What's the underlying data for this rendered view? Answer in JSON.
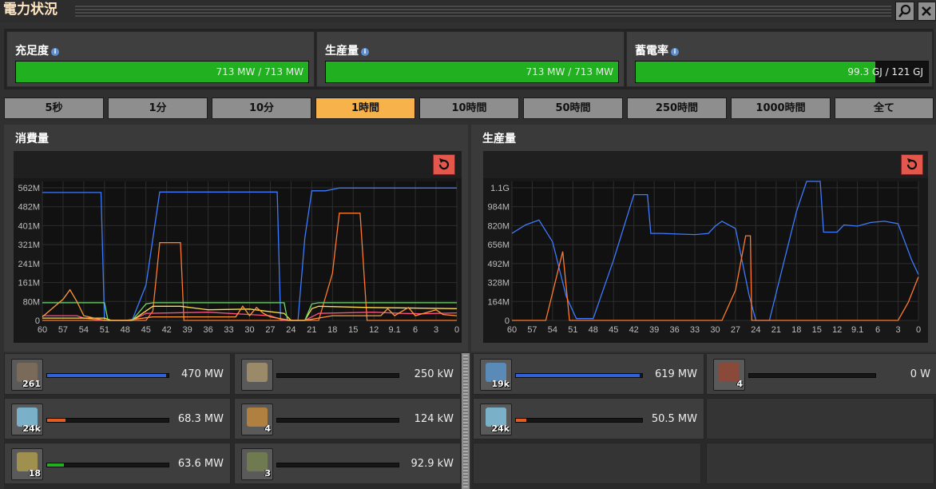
{
  "window": {
    "title": "電力状況"
  },
  "stats": [
    {
      "label": "充足度",
      "value_text": "713 MW / 713 MW",
      "fill": 1.0
    },
    {
      "label": "生産量",
      "value_text": "713 MW / 713 MW",
      "fill": 1.0
    },
    {
      "label": "蓄電率",
      "value_text": "99.3 GJ / 121 GJ",
      "fill": 0.82
    }
  ],
  "time_tabs": [
    "5秒",
    "1分",
    "10分",
    "1時間",
    "10時間",
    "50時間",
    "250時間",
    "1000時間",
    "全て"
  ],
  "active_tab": "1時間",
  "panels": {
    "consumption": {
      "title": "消費量"
    },
    "production": {
      "title": "生産量"
    }
  },
  "icons": {
    "search": "search-icon",
    "close": "close-icon",
    "reset": "reset-icon",
    "info": "info-icon"
  },
  "colors": {
    "bar_green": "#21b01f",
    "tab_active": "#f7b24c",
    "reset_red": "#e4574b",
    "series_blue": "#3d7bff",
    "series_orange": "#ff7a2e"
  },
  "chart_data": [
    {
      "type": "line",
      "x_ticks": [
        "60",
        "57",
        "54",
        "51",
        "48",
        "45",
        "42",
        "39",
        "36",
        "33",
        "30",
        "27",
        "24",
        "21",
        "18",
        "15",
        "12",
        "9.1",
        "6",
        "3",
        "0"
      ],
      "y_ticks": [
        "0",
        "80M",
        "161M",
        "241M",
        "321M",
        "401M",
        "482M",
        "562M"
      ],
      "ylim": [
        0,
        590
      ],
      "series": [
        {
          "color": "#3d7bff",
          "points": [
            [
              60,
              543
            ],
            [
              51.5,
              543
            ],
            [
              51,
              0
            ],
            [
              47,
              0
            ],
            [
              45,
              150
            ],
            [
              43,
              545
            ],
            [
              31,
              545
            ],
            [
              26,
              545
            ],
            [
              25.5,
              0
            ],
            [
              23,
              0
            ],
            [
              22,
              350
            ],
            [
              21,
              550
            ],
            [
              19,
              550
            ],
            [
              17,
              562
            ],
            [
              0,
              562
            ]
          ]
        },
        {
          "color": "#ff7a2e",
          "points": [
            [
              60,
              0
            ],
            [
              49,
              0
            ],
            [
              45,
              0
            ],
            [
              44,
              40
            ],
            [
              43,
              330
            ],
            [
              40,
              330
            ],
            [
              39.5,
              0
            ],
            [
              20,
              0
            ],
            [
              18,
              200
            ],
            [
              17,
              455
            ],
            [
              14,
              455
            ],
            [
              13,
              0
            ],
            [
              0,
              0
            ]
          ]
        },
        {
          "color": "#ff5080",
          "points": [
            [
              60,
              20
            ],
            [
              55,
              20
            ],
            [
              54,
              10
            ],
            [
              51,
              0
            ],
            [
              47,
              0
            ],
            [
              45,
              30
            ],
            [
              36,
              35
            ],
            [
              33,
              30
            ],
            [
              30,
              25
            ],
            [
              27,
              20
            ],
            [
              25,
              0
            ],
            [
              22,
              0
            ],
            [
              20,
              30
            ],
            [
              12,
              35
            ],
            [
              8,
              30
            ],
            [
              5,
              28
            ],
            [
              0,
              32
            ]
          ]
        },
        {
          "color": "#ffe14a",
          "points": [
            [
              60,
              10
            ],
            [
              51,
              10
            ],
            [
              50,
              0
            ],
            [
              47,
              0
            ],
            [
              45,
              40
            ],
            [
              44,
              60
            ],
            [
              40,
              60
            ],
            [
              36,
              45
            ],
            [
              30,
              48
            ],
            [
              25,
              30
            ],
            [
              24,
              0
            ],
            [
              22,
              0
            ],
            [
              21,
              50
            ],
            [
              20,
              60
            ],
            [
              13,
              55
            ],
            [
              0,
              50
            ]
          ]
        },
        {
          "color": "#6ed96e",
          "points": [
            [
              60,
              75
            ],
            [
              51,
              75
            ],
            [
              50.5,
              0
            ],
            [
              47,
              0
            ],
            [
              45,
              70
            ],
            [
              44,
              75
            ],
            [
              25,
              75
            ],
            [
              24.5,
              0
            ],
            [
              22,
              0
            ],
            [
              21,
              70
            ],
            [
              20,
              75
            ],
            [
              0,
              75
            ]
          ]
        },
        {
          "color": "#ff9a3a",
          "points": [
            [
              60,
              15
            ],
            [
              59,
              40
            ],
            [
              57,
              90
            ],
            [
              56,
              130
            ],
            [
              55,
              80
            ],
            [
              54,
              20
            ],
            [
              51,
              0
            ],
            [
              48,
              0
            ],
            [
              44,
              15
            ],
            [
              32,
              15
            ],
            [
              31,
              60
            ],
            [
              30,
              20
            ],
            [
              29,
              55
            ],
            [
              28,
              30
            ],
            [
              27,
              15
            ],
            [
              24,
              0
            ],
            [
              22,
              0
            ],
            [
              18,
              20
            ],
            [
              11,
              20
            ],
            [
              10,
              50
            ],
            [
              9,
              20
            ],
            [
              7,
              55
            ],
            [
              6,
              20
            ],
            [
              3,
              45
            ],
            [
              2,
              25
            ],
            [
              0,
              20
            ]
          ]
        }
      ]
    },
    {
      "type": "line",
      "x_ticks": [
        "60",
        "57",
        "54",
        "51",
        "48",
        "45",
        "42",
        "39",
        "36",
        "33",
        "30",
        "27",
        "24",
        "21",
        "18",
        "15",
        "12",
        "9.1",
        "6",
        "3",
        "0"
      ],
      "y_ticks": [
        "0",
        "164M",
        "328M",
        "492M",
        "656M",
        "820M",
        "984M",
        "1.1G"
      ],
      "ylim": [
        0,
        1150
      ],
      "series": [
        {
          "color": "#3d7bff",
          "points": [
            [
              60,
              720
            ],
            [
              58,
              790
            ],
            [
              56,
              830
            ],
            [
              54,
              650
            ],
            [
              52,
              200
            ],
            [
              50.5,
              15
            ],
            [
              48,
              15
            ],
            [
              45,
              500
            ],
            [
              42,
              1040
            ],
            [
              40,
              1040
            ],
            [
              39.5,
              720
            ],
            [
              38,
              720
            ],
            [
              33,
              710
            ],
            [
              31,
              720
            ],
            [
              30,
              780
            ],
            [
              29,
              820
            ],
            [
              27,
              760
            ],
            [
              25,
              210
            ],
            [
              24,
              0
            ],
            [
              22,
              0
            ],
            [
              20,
              450
            ],
            [
              18,
              900
            ],
            [
              16.5,
              1150
            ],
            [
              14.5,
              1150
            ],
            [
              14,
              730
            ],
            [
              12,
              730
            ],
            [
              11,
              790
            ],
            [
              9,
              780
            ],
            [
              7,
              810
            ],
            [
              5,
              820
            ],
            [
              3,
              800
            ],
            [
              2,
              650
            ],
            [
              1,
              500
            ],
            [
              0,
              380
            ]
          ]
        },
        {
          "color": "#ff7a2e",
          "points": [
            [
              60,
              0
            ],
            [
              55,
              0
            ],
            [
              52.5,
              570
            ],
            [
              51.5,
              0
            ],
            [
              29,
              0
            ],
            [
              27,
              250
            ],
            [
              25.5,
              700
            ],
            [
              24.8,
              700
            ],
            [
              24.6,
              0
            ],
            [
              3,
              0
            ],
            [
              1.5,
              150
            ],
            [
              0,
              360
            ]
          ]
        }
      ]
    }
  ],
  "consumers": [
    {
      "name": "consumer-a",
      "icon": "assembler-icon",
      "count": "261",
      "value": "470 MW",
      "fill": 0.98,
      "color": "#2f62d8"
    },
    {
      "name": "consumer-b",
      "icon": "inserter-icon",
      "count": "",
      "value": "250 kW",
      "fill": 0,
      "color": "#2f62d8"
    },
    {
      "name": "consumer-c",
      "icon": "lamp-icon",
      "count": "24k",
      "value": "68.3 MW",
      "fill": 0.15,
      "color": "#e35c20"
    },
    {
      "name": "consumer-d",
      "icon": "robot-icon",
      "count": "4",
      "value": "124 kW",
      "fill": 0,
      "color": "#2f62d8"
    },
    {
      "name": "consumer-e",
      "icon": "drill-icon",
      "count": "18",
      "value": "63.6 MW",
      "fill": 0.14,
      "color": "#21b01f"
    },
    {
      "name": "consumer-f",
      "icon": "radar-icon",
      "count": "3",
      "value": "92.9 kW",
      "fill": 0,
      "color": "#2f62d8"
    }
  ],
  "producers": [
    {
      "name": "producer-a",
      "icon": "solar-panel-icon",
      "count": "19k",
      "value": "619 MW",
      "fill": 0.98,
      "color": "#2f62d8"
    },
    {
      "name": "producer-b",
      "icon": "steam-engine-icon",
      "count": "4",
      "value": "0 W",
      "fill": 0,
      "color": "#2f62d8"
    },
    {
      "name": "producer-c",
      "icon": "accumulator-icon",
      "count": "24k",
      "value": "50.5 MW",
      "fill": 0.08,
      "color": "#e35c20"
    }
  ]
}
